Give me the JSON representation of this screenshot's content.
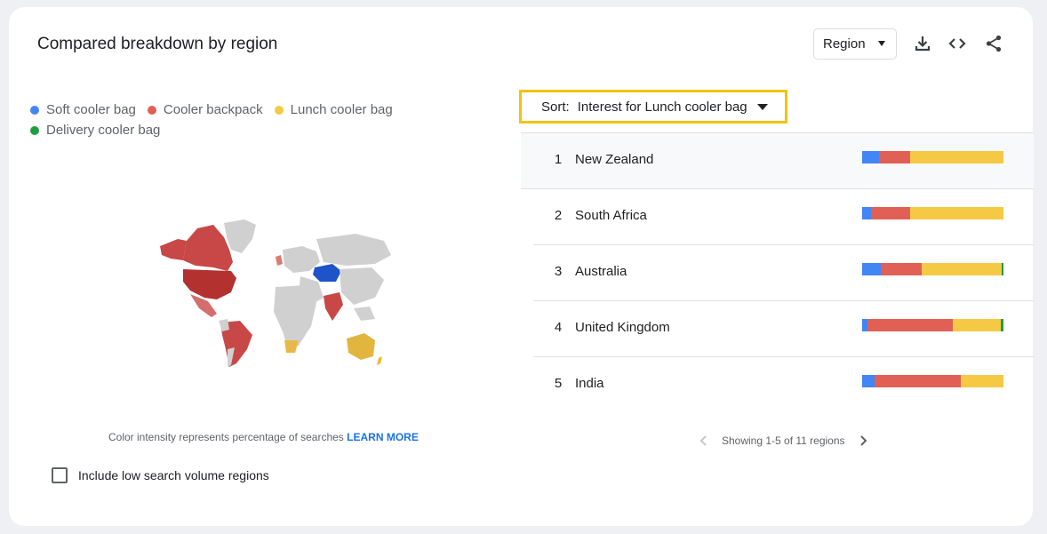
{
  "header": {
    "title": "Compared breakdown by region",
    "region_selector": "Region",
    "icons": [
      "download-icon",
      "embed-code-icon",
      "share-icon"
    ]
  },
  "legend": [
    {
      "label": "Soft cooler bag",
      "color": "#4285f4"
    },
    {
      "label": "Cooler backpack",
      "color": "#db4437"
    },
    {
      "label": "Lunch cooler bag",
      "color": "#f4c20d"
    },
    {
      "label": "Delivery cooler bag",
      "color": "#0f9d58"
    }
  ],
  "map": {
    "footnote_text": "Color intensity represents percentage of searches",
    "learn_more": "LEARN MORE"
  },
  "options": {
    "low_volume_label": "Include low search volume regions",
    "low_volume_checked": false
  },
  "sort": {
    "label": "Sort:",
    "value": "Interest for Lunch cooler bag"
  },
  "regions": [
    {
      "rank": "1",
      "name": "New Zealand",
      "shares": [
        12,
        22,
        66,
        0
      ]
    },
    {
      "rank": "2",
      "name": "South Africa",
      "shares": [
        6,
        28,
        66,
        0
      ]
    },
    {
      "rank": "3",
      "name": "Australia",
      "shares": [
        13,
        29,
        57,
        1
      ]
    },
    {
      "rank": "4",
      "name": "United Kingdom",
      "shares": [
        4,
        60,
        34,
        2
      ]
    },
    {
      "rank": "5",
      "name": "India",
      "shares": [
        9,
        61,
        30,
        0
      ]
    }
  ],
  "pagination": {
    "text": "Showing 1-5 of 11 regions"
  }
}
